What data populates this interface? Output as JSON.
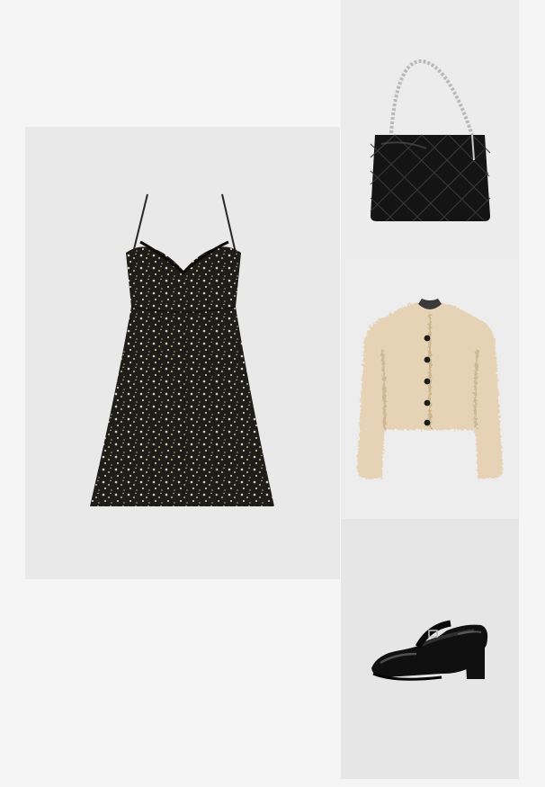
{
  "items": [
    {
      "id": "dress",
      "name": "",
      "color": "#1f1d1a"
    },
    {
      "id": "bag",
      "name": "",
      "color": "#141414"
    },
    {
      "id": "jacket",
      "name": "",
      "color": "#e6d3b6"
    },
    {
      "id": "shoe",
      "name": "",
      "color": "#0f0f0f"
    }
  ]
}
